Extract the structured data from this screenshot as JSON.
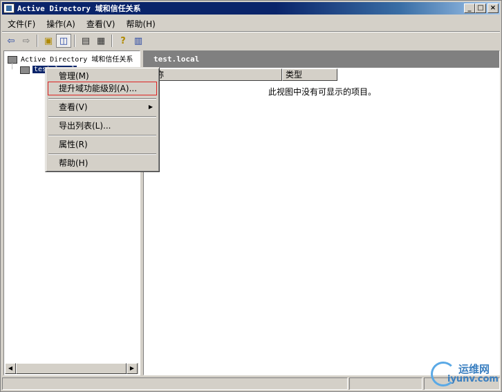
{
  "window": {
    "title": "Active Directory 域和信任关系",
    "controls": {
      "minimize": "_",
      "maximize": "□",
      "close": "×"
    }
  },
  "menubar": [
    {
      "label": "文件(F)"
    },
    {
      "label": "操作(A)"
    },
    {
      "label": "查看(V)"
    },
    {
      "label": "帮助(H)"
    }
  ],
  "toolbar": {
    "icons": [
      "back-arrow-icon",
      "forward-arrow-icon",
      "up-folder-icon",
      "show-hide-tree-icon",
      "properties-icon",
      "export-list-icon",
      "help-icon",
      "console-icon"
    ],
    "glyphs": {
      "back": "⇦",
      "forward": "⇨",
      "up": "▣",
      "tree": "◫",
      "props": "▤",
      "export": "▦",
      "help": "?",
      "console": "▥"
    }
  },
  "tree": {
    "root_label": "Active Directory 域和信任关系",
    "child_label": "test.local"
  },
  "right_pane": {
    "header_label": "test.local",
    "columns": [
      "名称",
      "类型"
    ],
    "empty_message": "此视图中没有可显示的项目。"
  },
  "context_menu": {
    "items": [
      {
        "label": "管理(M)",
        "highlighted": false
      },
      {
        "label": "提升域功能级别(A)...",
        "highlighted": true
      },
      {
        "label": "查看(V)",
        "has_submenu": true
      },
      {
        "label": "导出列表(L)..."
      },
      {
        "label": "属性(R)"
      },
      {
        "label": "帮助(H)"
      }
    ],
    "submenu_arrow": "▶"
  },
  "scrollbar": {
    "left": "◀",
    "right": "▶"
  },
  "watermark": {
    "line1": "运维网",
    "line2": "iyunv.com"
  },
  "colors": {
    "title_bar": "#0a246a",
    "highlight_border": "#dd2222",
    "face": "#d4d0c8"
  }
}
